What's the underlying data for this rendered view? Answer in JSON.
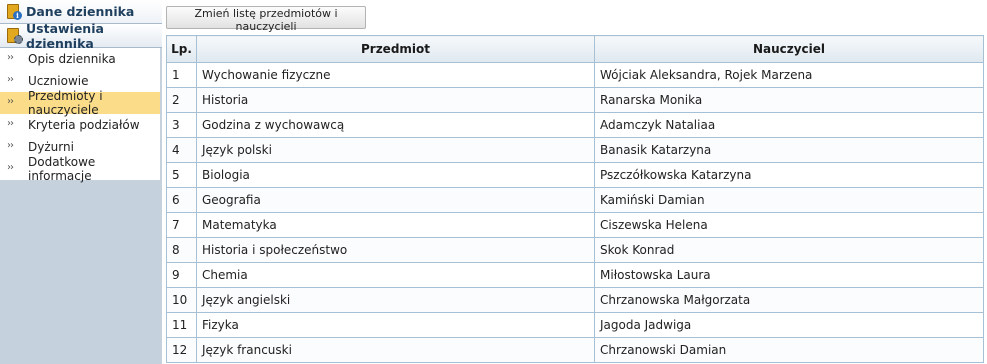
{
  "sidebar": {
    "header1": "Dane dziennika",
    "header2": "Ustawienia dziennika",
    "items": [
      {
        "label": "Opis dziennika"
      },
      {
        "label": "Uczniowie"
      },
      {
        "label": "Przedmioty i nauczyciele",
        "active": true
      },
      {
        "label": "Kryteria podziałów"
      },
      {
        "label": "Dyżurni"
      },
      {
        "label": "Dodatkowe informacje"
      }
    ]
  },
  "toolbar": {
    "change_button": "Zmień listę przedmiotów i nauczycieli"
  },
  "table": {
    "headers": {
      "lp": "Lp.",
      "subject": "Przedmiot",
      "teacher": "Nauczyciel"
    },
    "rows": [
      {
        "lp": "1",
        "subject": "Wychowanie fizyczne",
        "teacher": "Wójciak Aleksandra, Rojek Marzena"
      },
      {
        "lp": "2",
        "subject": "Historia",
        "teacher": "Ranarska Monika"
      },
      {
        "lp": "3",
        "subject": "Godzina z wychowawcą",
        "teacher": "Adamczyk Nataliaa"
      },
      {
        "lp": "4",
        "subject": "Język polski",
        "teacher": "Banasik Katarzyna"
      },
      {
        "lp": "5",
        "subject": "Biologia",
        "teacher": "Pszczółkowska Katarzyna"
      },
      {
        "lp": "6",
        "subject": "Geografia",
        "teacher": "Kamiński Damian"
      },
      {
        "lp": "7",
        "subject": "Matematyka",
        "teacher": "Ciszewska Helena"
      },
      {
        "lp": "8",
        "subject": "Historia i społeczeństwo",
        "teacher": "Skok Konrad"
      },
      {
        "lp": "9",
        "subject": "Chemia",
        "teacher": "Miłostowska Laura"
      },
      {
        "lp": "10",
        "subject": "Język angielski",
        "teacher": "Chrzanowska Małgorzata"
      },
      {
        "lp": "11",
        "subject": "Fizyka",
        "teacher": "Jagoda Jadwiga"
      },
      {
        "lp": "12",
        "subject": "Język francuski",
        "teacher": "Chrzanowski Damian"
      }
    ]
  }
}
